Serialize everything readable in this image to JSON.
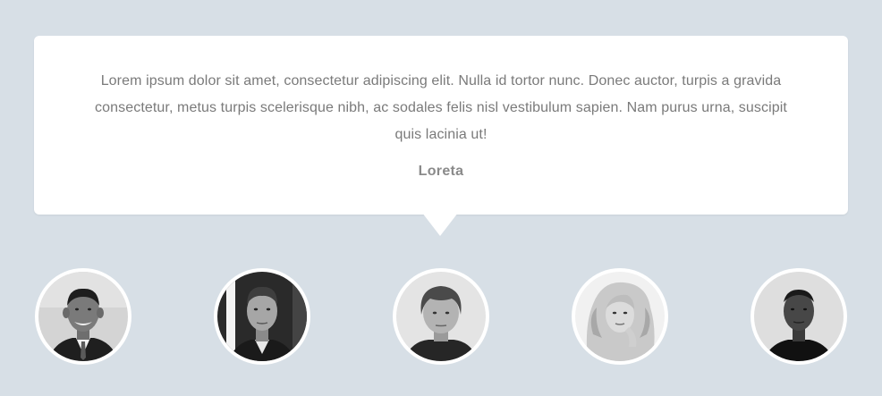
{
  "testimonial": {
    "text": "Lorem ipsum dolor sit amet, consectetur adipiscing elit. Nulla id tortor nunc. Donec auctor, turpis a gravida consectetur, metus turpis scelerisque nibh, ac sodales felis nisl vestibulum sapien. Nam purus urna, suscipit quis lacinia ut!",
    "author": "Loreta"
  },
  "colors": {
    "background": "#d7dfe6",
    "card": "#ffffff",
    "text": "#7a7a7a"
  },
  "avatars": [
    {
      "icon": "person-portrait-icon"
    },
    {
      "icon": "person-portrait-icon"
    },
    {
      "icon": "person-portrait-icon",
      "active": true
    },
    {
      "icon": "person-portrait-icon"
    },
    {
      "icon": "person-portrait-icon"
    }
  ]
}
